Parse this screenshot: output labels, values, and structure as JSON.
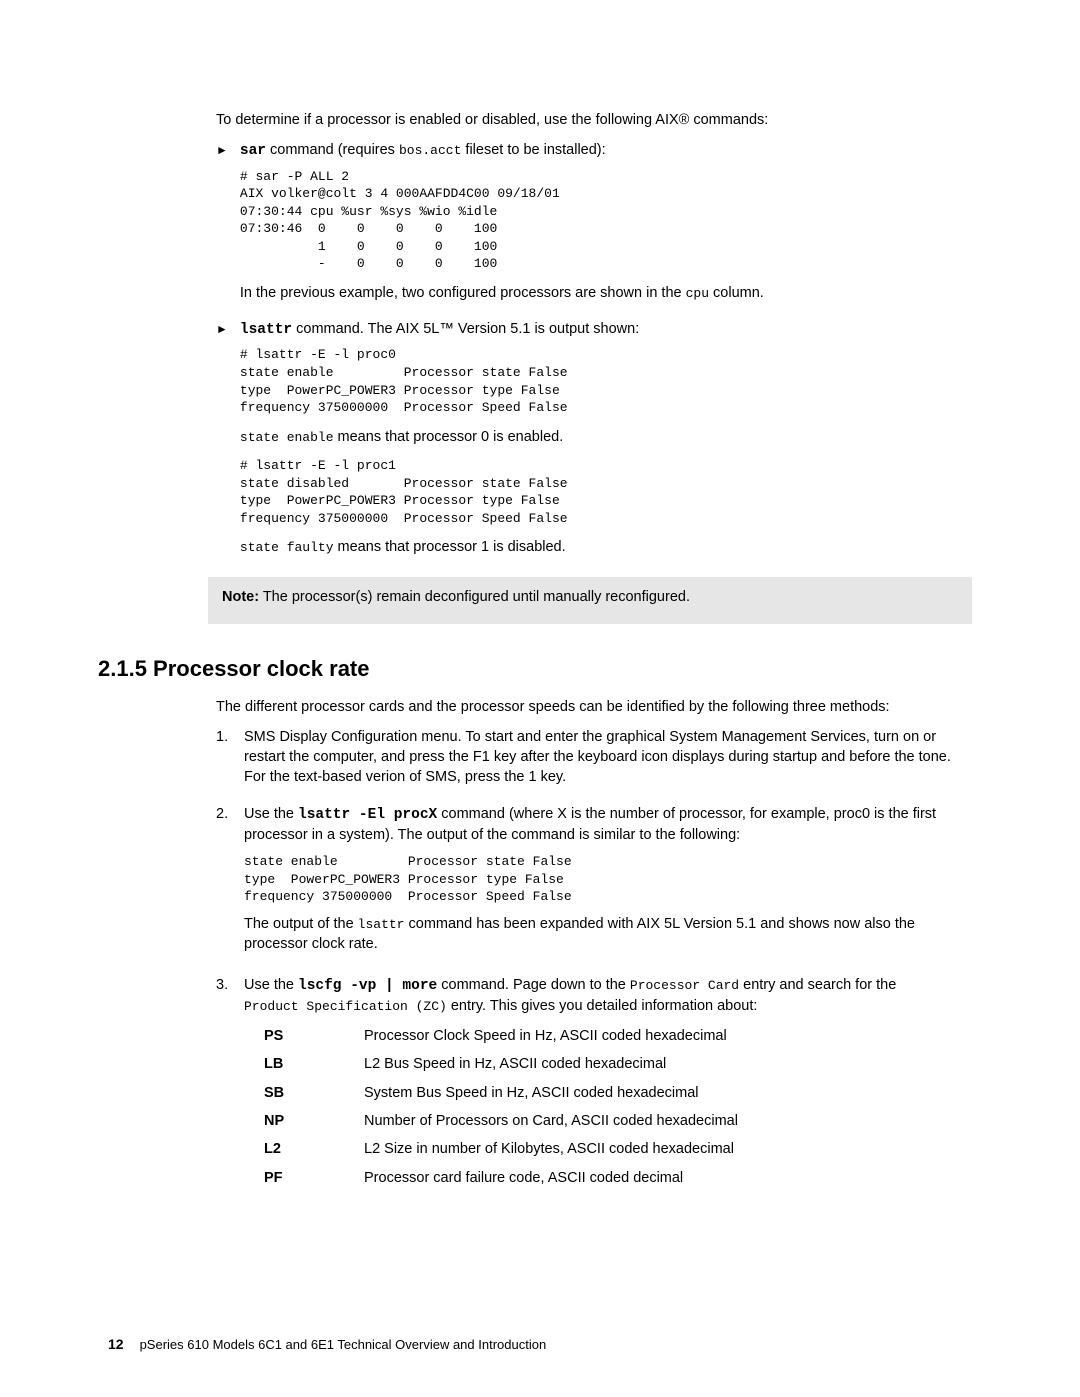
{
  "intro": "To determine if a processor is enabled or disabled, use the following AIX® commands:",
  "bullets": [
    {
      "cmd": "sar",
      "tail_a": " command (requires ",
      "pkg": "bos.acct",
      "tail_b": " fileset to be installed):",
      "code": "# sar -P ALL 2\nAIX volker@colt 3 4 000AAFDD4C00 09/18/01\n07:30:44 cpu %usr %sys %wio %idle\n07:30:46  0    0    0    0    100\n          1    0    0    0    100\n          -    0    0    0    100",
      "after_a": "In the previous example, two configured processors are shown in the ",
      "after_code": "cpu",
      "after_b": " column."
    },
    {
      "cmd": "lsattr",
      "tail": " command. The AIX 5L™ Version 5.1 is output shown:",
      "code1": "# lsattr -E -l proc0\nstate enable         Processor state False\ntype  PowerPC_POWER3 Processor type False\nfrequency 375000000  Processor Speed False",
      "mid_code": "state enable",
      "mid_text": " means that processor 0 is enabled.",
      "code2": "# lsattr -E -l proc1\nstate disabled       Processor state False\ntype  PowerPC_POWER3 Processor type False\nfrequency 375000000  Processor Speed False",
      "end_code": "state faulty",
      "end_text": " means that processor 1 is disabled."
    }
  ],
  "note_label": "Note:",
  "note_text": " The processor(s) remain deconfigured until manually reconfigured.",
  "heading": "2.1.5  Processor clock rate",
  "section_intro": "The different processor cards and the processor speeds can be identified by the following three methods:",
  "steps": [
    {
      "n": "1.",
      "text": "SMS Display Configuration menu. To start and enter the graphical System Management Services, turn on or restart the computer, and press the F1 key after the keyboard icon displays during startup and before the tone. For the text-based verion of SMS, press the 1 key."
    },
    {
      "n": "2.",
      "pre": "Use the ",
      "cmd": "lsattr -El procX",
      "post": " command (where X is the number of processor, for example, proc0 is the first processor in a system). The output of the command is similar to the following:",
      "code": "state enable         Processor state False\ntype  PowerPC_POWER3 Processor type False\nfrequency 375000000  Processor Speed False",
      "after_a": "The output of the ",
      "after_code": "lsattr",
      "after_b": " command has been expanded with AIX 5L Version 5.1 and shows now also the processor clock rate."
    },
    {
      "n": "3.",
      "pre": "Use the ",
      "cmd": "lscfg -vp | more",
      "mid1": " command. Page down to the ",
      "code1": "Processor Card",
      "mid2": " entry and search for the ",
      "code2": "Product Specification (ZC)",
      "mid3": " entry. This gives you detailed information about:"
    }
  ],
  "defs": [
    {
      "k": "PS",
      "v": "Processor Clock Speed in Hz, ASCII coded hexadecimal"
    },
    {
      "k": "LB",
      "v": "L2 Bus Speed in Hz, ASCII coded hexadecimal"
    },
    {
      "k": "SB",
      "v": "System Bus Speed in Hz, ASCII coded hexadecimal"
    },
    {
      "k": "NP",
      "v": "Number of Processors on Card, ASCII coded hexadecimal"
    },
    {
      "k": "L2",
      "v": "L2 Size in number of Kilobytes, ASCII coded hexadecimal"
    },
    {
      "k": "PF",
      "v": "Processor card failure code, ASCII coded decimal"
    }
  ],
  "page_number": "12",
  "footer_title": "pSeries 610 Models 6C1 and 6E1 Technical Overview and Introduction"
}
